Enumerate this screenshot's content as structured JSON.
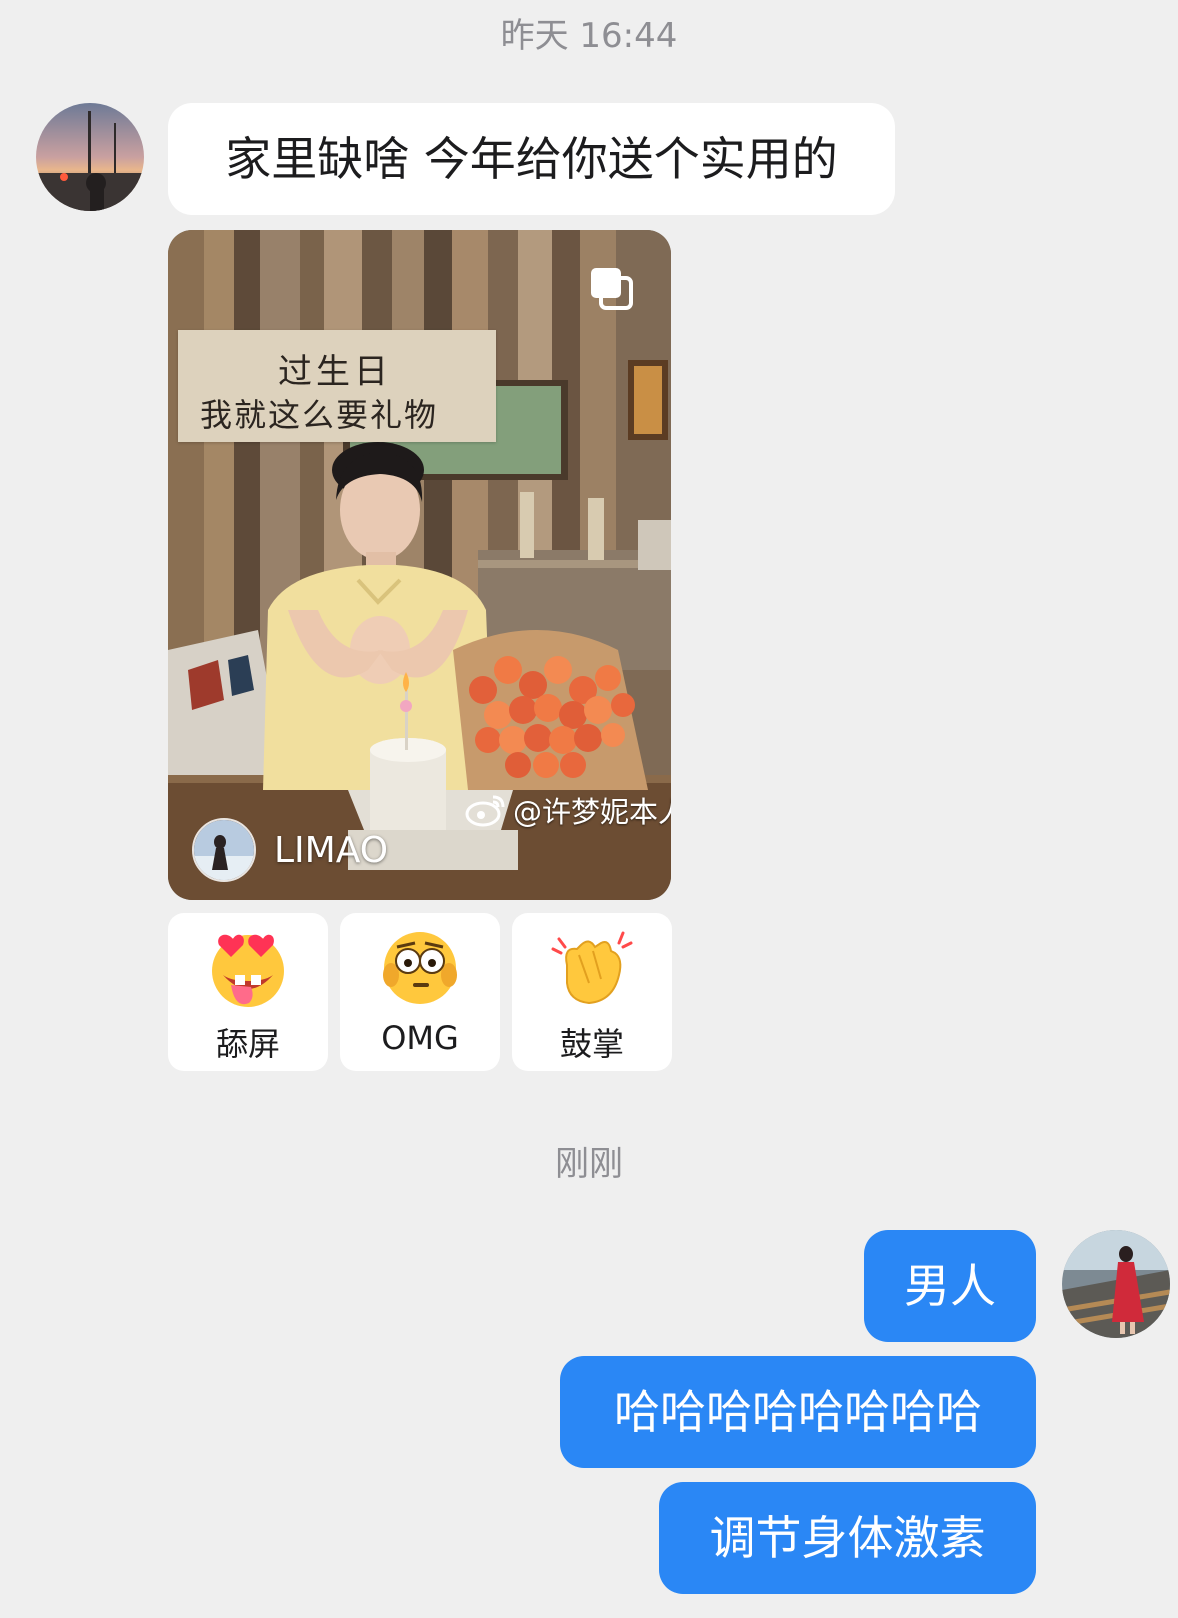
{
  "timestamps": {
    "first": "昨天 16:44",
    "second": "刚刚"
  },
  "incoming": {
    "text": "家里缺啥 今年给你送个实用的"
  },
  "post": {
    "note_line1": "过生日",
    "note_line2": "我就这么要礼物",
    "watermark": "@许梦妮本人",
    "author": "LIMAO"
  },
  "reactions": [
    {
      "label": "舔屏",
      "icon": "drooling-heart-eyes-emoji"
    },
    {
      "label": "OMG",
      "icon": "shocked-face-emoji"
    },
    {
      "label": "鼓掌",
      "icon": "clapping-hands-emoji"
    }
  ],
  "outgoing": [
    "男人",
    "哈哈哈哈哈哈哈哈",
    "调节身体激素"
  ],
  "colors": {
    "background": "#efefef",
    "outgoing_bubble": "#2a87f5",
    "incoming_bubble": "#ffffff"
  }
}
